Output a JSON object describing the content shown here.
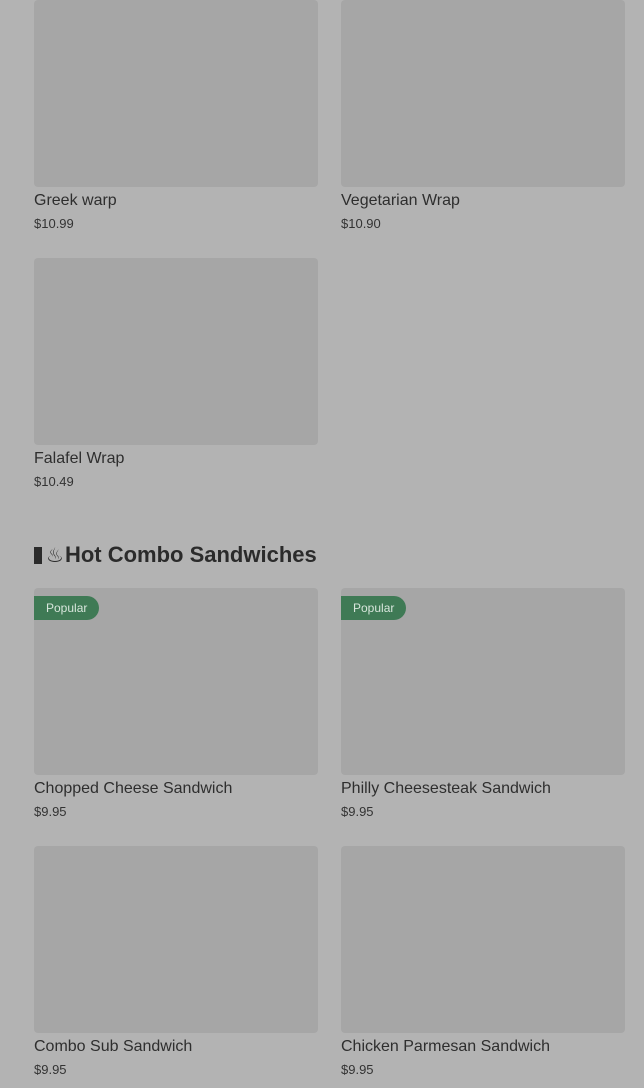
{
  "wraps": {
    "items": [
      {
        "name": "Greek warp",
        "price": "$10.99"
      },
      {
        "name": "Vegetarian Wrap",
        "price": "$10.90"
      },
      {
        "name": "Falafel Wrap",
        "price": "$10.49"
      }
    ]
  },
  "hot_combo": {
    "title": "Hot Combo Sandwiches",
    "icons": [
      "bar-icon",
      "steam-icon"
    ],
    "items": [
      {
        "name": "Chopped Cheese Sandwich",
        "price": "$9.95",
        "badge": "Popular"
      },
      {
        "name": "Philly Cheesesteak Sandwich",
        "price": "$9.95",
        "badge": "Popular"
      },
      {
        "name": "Combo Sub Sandwich",
        "price": "$9.95"
      },
      {
        "name": "Chicken Parmesan Sandwich",
        "price": "$9.95"
      }
    ]
  },
  "colors": {
    "background": "#b3b3b3",
    "thumbnail": "#a6a6a6",
    "badge": "#3f7a55",
    "text": "#2b2b2b"
  }
}
